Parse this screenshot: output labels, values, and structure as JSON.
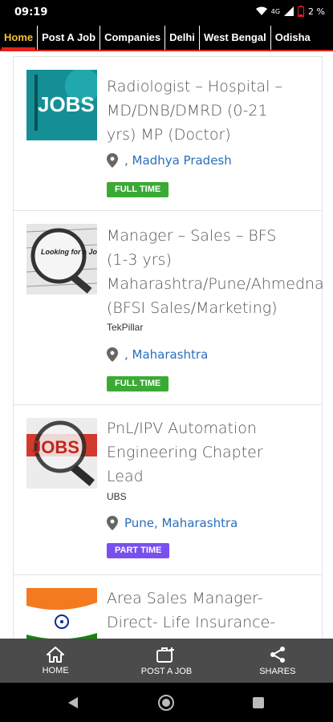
{
  "status": {
    "time": "09:19",
    "network": "4G",
    "battery": "2 %"
  },
  "tabs": [
    {
      "label": "Home",
      "active": true
    },
    {
      "label": "Post A Job"
    },
    {
      "label": "Companies"
    },
    {
      "label": "Delhi"
    },
    {
      "label": "West Bengal"
    },
    {
      "label": "Odisha"
    }
  ],
  "jobs": [
    {
      "thumb_text": "JOBS",
      "title_lines": [
        "Radiologist – Hospital –",
        "MD/DNB/DMRD (0-21",
        "yrs) MP (Doctor)"
      ],
      "company": "",
      "location": ", Madhya Pradesh",
      "type": "FULL TIME"
    },
    {
      "thumb_text": "Looking for a Job",
      "title_lines": [
        "Manager – Sales – BFS",
        "(1-3 yrs)",
        "Maharashtra/Pune/Ahmedna",
        "(BFSI Sales/Marketing)"
      ],
      "company": "TekPillar",
      "location": ", Maharashtra",
      "type": "FULL TIME"
    },
    {
      "thumb_text": "JOBS",
      "title_lines": [
        "PnL/IPV Automation",
        "Engineering Chapter",
        "Lead"
      ],
      "company": "UBS",
      "location": "Pune, Maharashtra",
      "type": "PART TIME"
    },
    {
      "thumb_text": "",
      "title_lines": [
        "Area Sales Manager-",
        "Direct- Life Insurance-"
      ],
      "company": "",
      "location": "",
      "type": ""
    }
  ],
  "bottom_nav": [
    {
      "label": "HOME",
      "icon": "home-icon"
    },
    {
      "label": "POST A JOB",
      "icon": "briefcase-add-icon"
    },
    {
      "label": "SHARES",
      "icon": "share-icon"
    }
  ],
  "colors": {
    "accent": "#e2231a",
    "active_tab": "#f1c232",
    "link": "#2a6fbb",
    "full_time": "#3aaa35",
    "part_time": "#7a4ff0"
  }
}
